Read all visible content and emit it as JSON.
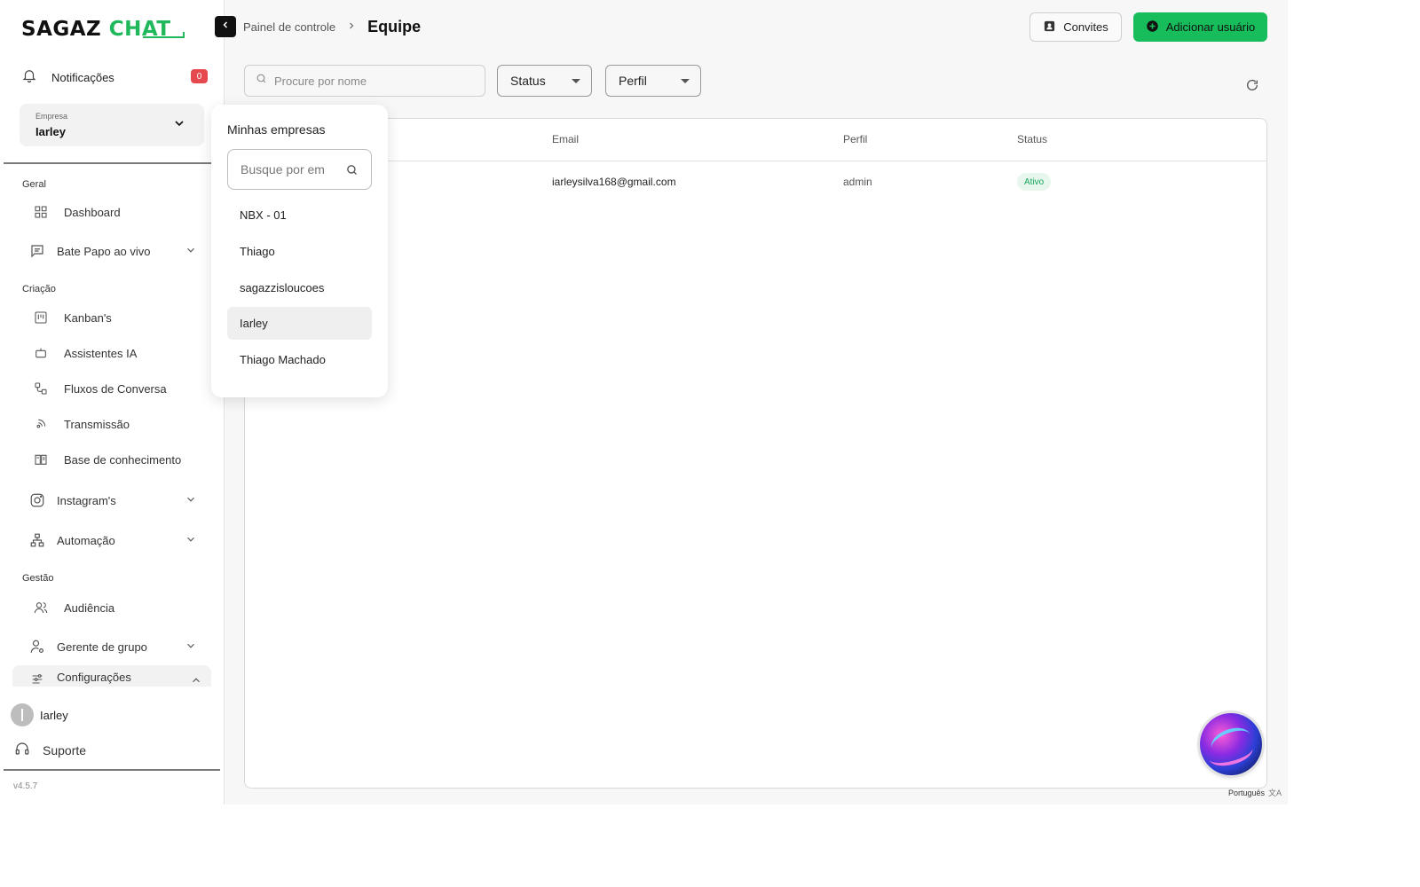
{
  "brand": {
    "part1": "SAGAZ ",
    "part2": "CHAT"
  },
  "sidebar": {
    "notifications": {
      "label": "Notificações",
      "count": "0"
    },
    "company": {
      "caption": "Empresa",
      "value": "Iarley"
    },
    "sections": {
      "geral": "Geral",
      "criacao": "Criação",
      "gestao": "Gestão"
    },
    "items": {
      "dashboard": "Dashboard",
      "bate_papo": "Bate Papo ao vivo",
      "kanbans": "Kanban's",
      "assistentes": "Assistentes IA",
      "fluxos": "Fluxos de Conversa",
      "transmissao": "Transmissão",
      "base": "Base de conhecimento",
      "instagram": "Instagram's",
      "automacao": "Automação",
      "audiencia": "Audiência",
      "gerente": "Gerente de grupo",
      "config": "Configurações"
    },
    "user_name": "Iarley",
    "support": "Suporte",
    "version": "v4.5.7"
  },
  "header": {
    "breadcrumb_parent": "Painel de controle",
    "breadcrumb_current": "Equipe",
    "invites_label": "Convites",
    "add_user_label": "Adicionar usuário"
  },
  "filters": {
    "search_placeholder": "Procure por nome",
    "status_label": "Status",
    "perfil_label": "Perfil"
  },
  "table": {
    "columns": {
      "email": "Email",
      "perfil": "Perfil",
      "status": "Status"
    },
    "rows": [
      {
        "email": "iarleysilva168@gmail.com",
        "perfil": "admin",
        "status": "Ativo"
      }
    ]
  },
  "dropdown": {
    "title": "Minhas empresas",
    "search_placeholder": "Busque por em",
    "items": [
      "NBX - 01",
      "Thiago",
      "sagazzisloucoes",
      "Iarley",
      "Thiago Machado"
    ],
    "selected": "Iarley"
  },
  "language": "Português",
  "colors": {
    "accent": "#17bd5a",
    "badge": "#e5484d",
    "status_active": "#19a65a"
  }
}
